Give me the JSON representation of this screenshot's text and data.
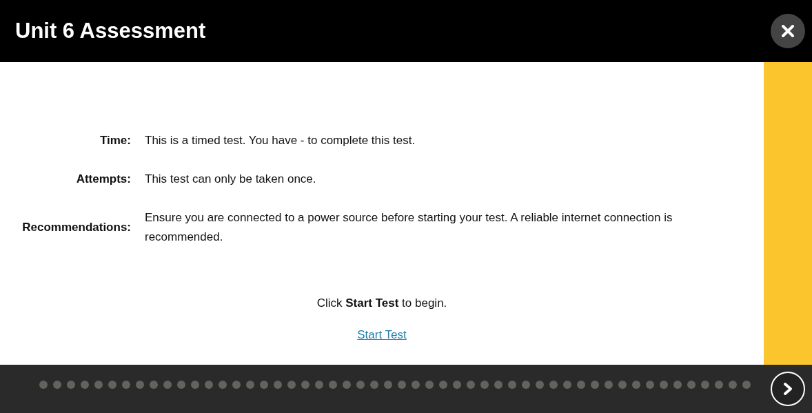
{
  "header": {
    "title": "Unit 6 Assessment"
  },
  "details": [
    {
      "label": "Time:",
      "text": "This is a timed test. You have - to complete this test."
    },
    {
      "label": "Attempts:",
      "text": "This test can only be taken once."
    },
    {
      "label": "Recommendations:",
      "text": "Ensure you are connected to a power source before starting your test. A reliable internet connection is recommended."
    }
  ],
  "instruction": "Click **Start Test** to begin.",
  "start_link": "Start Test",
  "pager": {
    "dots": [
      {
        "selected": false
      },
      {
        "selected": false
      },
      {
        "selected": false
      },
      {
        "selected": false
      },
      {
        "selected": false
      },
      {
        "selected": false
      },
      {
        "selected": false
      },
      {
        "selected": false
      },
      {
        "selected": false
      },
      {
        "selected": false
      },
      {
        "selected": false
      },
      {
        "selected": false
      },
      {
        "selected": false
      },
      {
        "selected": false
      },
      {
        "selected": false
      },
      {
        "selected": false
      },
      {
        "selected": false
      },
      {
        "selected": false
      },
      {
        "selected": false
      },
      {
        "selected": false
      },
      {
        "selected": false
      },
      {
        "selected": false
      },
      {
        "selected": false
      },
      {
        "selected": false
      },
      {
        "selected": false
      },
      {
        "selected": false
      },
      {
        "selected": false
      },
      {
        "selected": false
      },
      {
        "selected": false
      },
      {
        "selected": false
      },
      {
        "selected": false
      },
      {
        "selected": false
      },
      {
        "selected": false
      },
      {
        "selected": false
      },
      {
        "selected": false
      },
      {
        "selected": false
      },
      {
        "selected": false
      },
      {
        "selected": false
      },
      {
        "selected": false
      },
      {
        "selected": false
      },
      {
        "selected": false
      },
      {
        "selected": false
      },
      {
        "selected": false
      },
      {
        "selected": false
      },
      {
        "selected": false
      },
      {
        "selected": false
      },
      {
        "selected": false
      },
      {
        "selected": false
      },
      {
        "selected": false
      },
      {
        "selected": false
      },
      {
        "selected": false
      },
      {
        "selected": false
      }
    ]
  }
}
